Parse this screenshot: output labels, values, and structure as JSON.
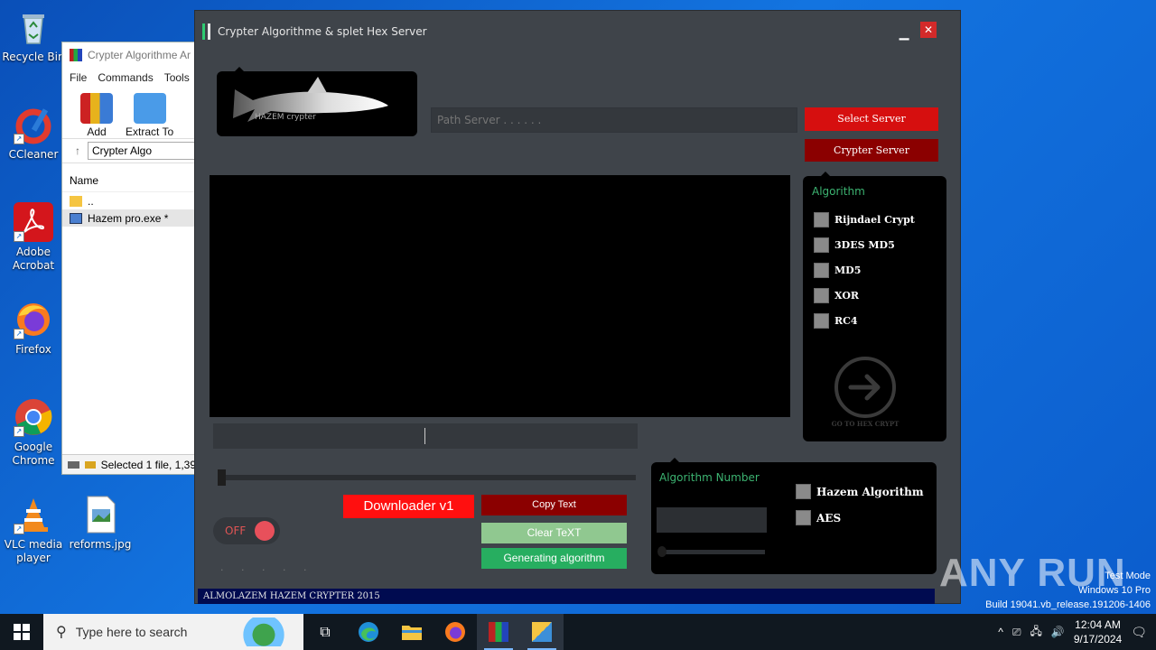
{
  "desktop": {
    "icons": [
      {
        "label": "Recycle Bin"
      },
      {
        "label": "CCleaner"
      },
      {
        "label": "Adobe Acrobat"
      },
      {
        "label": "Firefox"
      },
      {
        "label": "Google Chrome"
      },
      {
        "label": "VLC media player"
      },
      {
        "label": "reforms.jpg"
      }
    ]
  },
  "winrar": {
    "title": "Crypter Algorithme Ar",
    "menu": [
      "File",
      "Commands",
      "Tools"
    ],
    "tools": [
      "Add",
      "Extract To"
    ],
    "path": "Crypter Algo",
    "column_name": "Name",
    "rows": [
      "..",
      "Hazem pro.exe *"
    ],
    "status": "Selected 1 file, 1,39"
  },
  "app": {
    "title": "Crypter Algorithme  & splet Hex  Server",
    "logo_text": "HAZEM crypter",
    "path_placeholder": "Path Server . . . . . .",
    "select_server": "Select Server",
    "crypter_server": "Crypter Server",
    "algorithm_panel": {
      "title": "Algorithm",
      "items": [
        "Rijndael Crypt",
        "3DES MD5",
        "MD5",
        "XOR",
        "RC4"
      ],
      "go_label": "GO TO HEX CRYPT"
    },
    "toggle_label": "OFF",
    "dots": ". . . . .",
    "downloader": "Downloader v1",
    "copy_text": "Copy Text",
    "clear_text": "Clear TeXT",
    "generating": "Generating algorithm",
    "number_panel": {
      "title": "Algorithm Number",
      "items": [
        "Hazem Algorithm",
        "AES"
      ]
    },
    "status": "ALMOLAZEM HAZEM CRYPTER 2015"
  },
  "watermark": {
    "brand": "ANY RUN",
    "line1": "Test Mode",
    "line2": "Windows 10 Pro",
    "line3": "Build 19041.vb_release.191206-1406"
  },
  "taskbar": {
    "search_placeholder": "Type here to search",
    "time": "12:04 AM",
    "date": "9/17/2024"
  },
  "colors": {
    "window_bg": "#3f444a",
    "accent_red": "#d60f0f",
    "dark_red": "#8b0000",
    "green": "#27ae60",
    "label_green": "#3cb371",
    "status_blue": "#000b50"
  }
}
